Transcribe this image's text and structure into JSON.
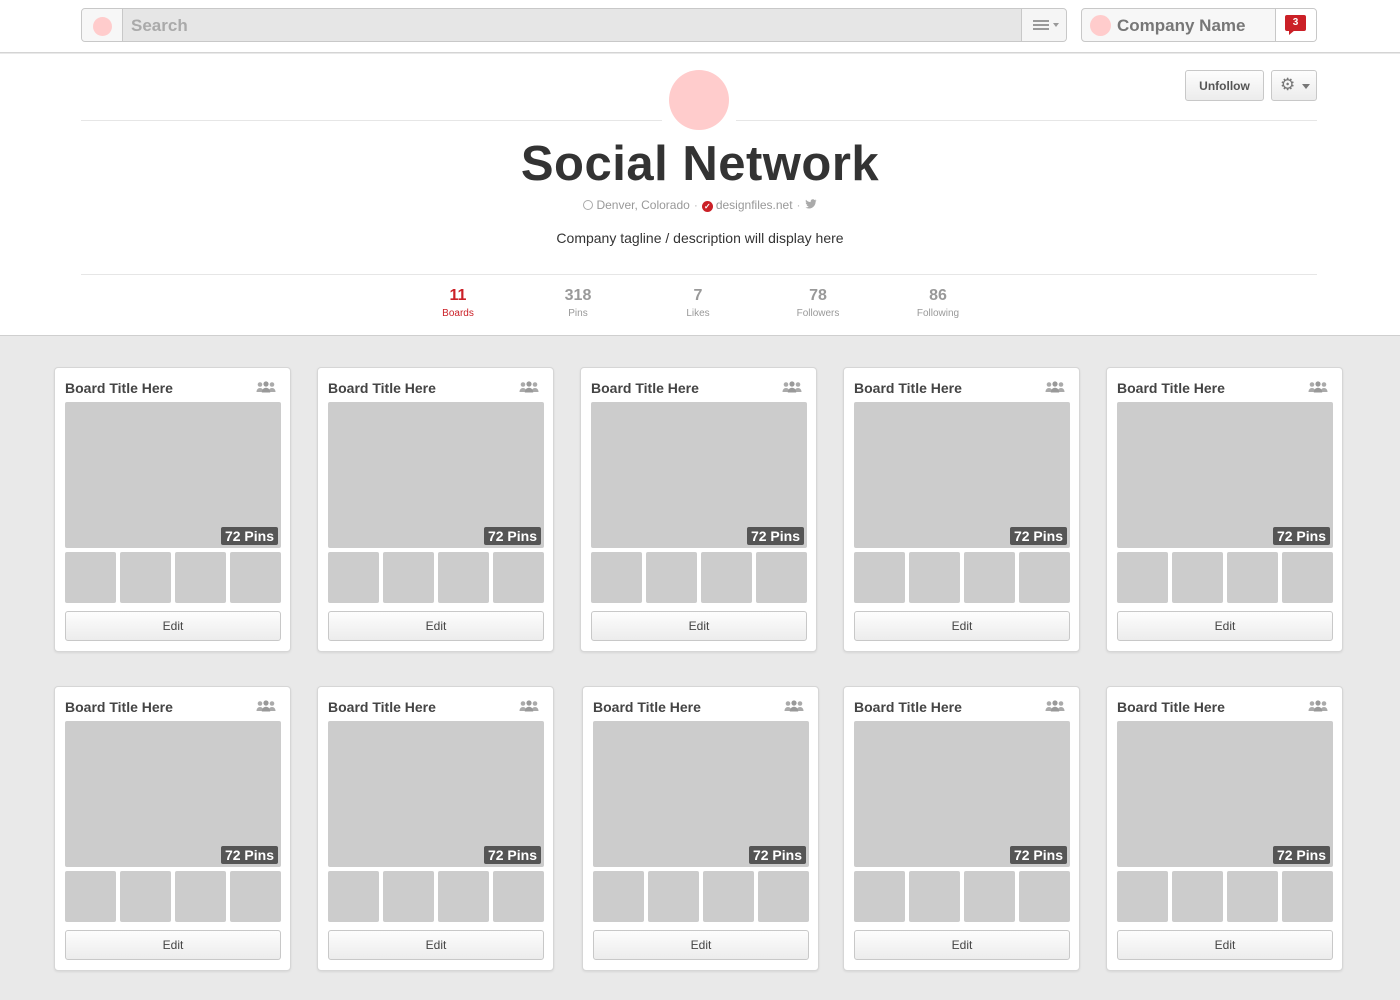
{
  "topbar": {
    "search_placeholder": "Search",
    "menu_icon": "menu-icon",
    "account_name": "Company Name",
    "notification_count": "3"
  },
  "profile": {
    "title": "Social Network",
    "location": "Denver, Colorado",
    "website": "designfiles.net",
    "tagline": "Company tagline / description will display here",
    "unfollow_label": "Unfollow",
    "settings_icon": "gear-icon"
  },
  "stats": [
    {
      "value": "11",
      "label": "Boards",
      "active": true
    },
    {
      "value": "318",
      "label": "Pins",
      "active": false
    },
    {
      "value": "7",
      "label": "Likes",
      "active": false
    },
    {
      "value": "78",
      "label": "Followers",
      "active": false
    },
    {
      "value": "86",
      "label": "Following",
      "active": false
    }
  ],
  "boards": [
    {
      "title": "Board Title Here",
      "pins": "72 Pins",
      "edit": "Edit"
    },
    {
      "title": "Board Title Here",
      "pins": "72 Pins",
      "edit": "Edit"
    },
    {
      "title": "Board Title Here",
      "pins": "72 Pins",
      "edit": "Edit"
    },
    {
      "title": "Board Title Here",
      "pins": "72 Pins",
      "edit": "Edit"
    },
    {
      "title": "Board Title Here",
      "pins": "72 Pins",
      "edit": "Edit"
    },
    {
      "title": "Board Title Here",
      "pins": "72 Pins",
      "edit": "Edit"
    },
    {
      "title": "Board Title Here",
      "pins": "72 Pins",
      "edit": "Edit"
    },
    {
      "title": "Board Title Here",
      "pins": "72 Pins",
      "edit": "Edit"
    },
    {
      "title": "Board Title Here",
      "pins": "72 Pins",
      "edit": "Edit"
    },
    {
      "title": "Board Title Here",
      "pins": "72 Pins",
      "edit": "Edit"
    }
  ],
  "colors": {
    "accent": "#cb2027",
    "placeholder": "#cccccc",
    "avatar": "#ffcccc",
    "page_bg": "#e9e9e9"
  }
}
